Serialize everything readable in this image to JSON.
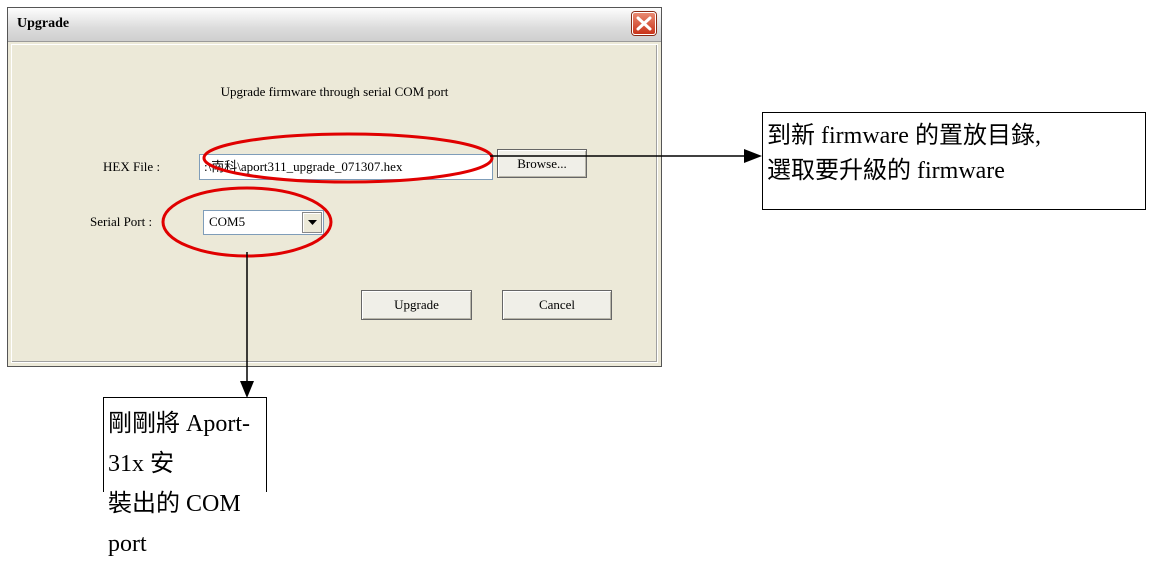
{
  "dialog": {
    "title": "Upgrade",
    "heading": "Upgrade firmware through serial COM port",
    "hex_file_label": "HEX File :",
    "hex_file_value": ":\\南科\\aport311_upgrade_071307.hex",
    "browse_label": "Browse...",
    "serial_port_label": "Serial Port :",
    "serial_port_value": "COM5",
    "upgrade_label": "Upgrade",
    "cancel_label": "Cancel"
  },
  "annotations": {
    "right_line1": "到新 firmware 的置放目錄,",
    "right_line2": "選取要升級的 firmware",
    "bottom_line1": "剛剛將 Aport-31x 安",
    "bottom_line2": "裝出的 COM port"
  },
  "colors": {
    "window_face": "#ece9d8",
    "highlight_ellipse": "#e00000",
    "close_button": "#c9341a"
  },
  "icons": [
    "close-icon",
    "dropdown-arrow-icon"
  ]
}
